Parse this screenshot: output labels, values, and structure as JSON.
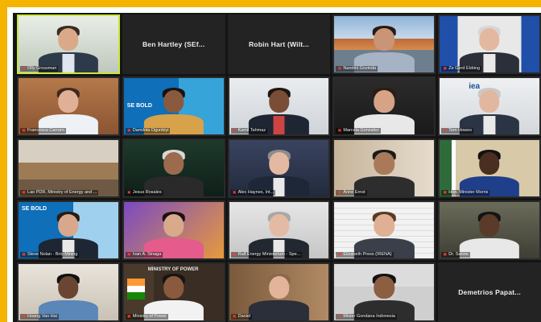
{
  "meeting": {
    "tiles": [
      {
        "name": "Olly Grossman",
        "muted": true
      },
      {
        "center": "Ben Hartley (SEf..."
      },
      {
        "center": "Robin Hart (Wilt..."
      },
      {
        "name": "Nandini Govinda",
        "muted": true
      },
      {
        "name": "Ze Gerd Ebbing",
        "muted": true
      },
      {
        "name": "Francesca Carraro",
        "muted": true
      },
      {
        "name": "Damilola Ogunbiyi",
        "muted": true
      },
      {
        "name": "Kamil Tahmaz",
        "muted": true
      },
      {
        "name": "Marcela Gonzalez",
        "muted": true
      },
      {
        "name": "Tom Howes",
        "muted": true
      },
      {
        "name": "Lao PDR, Ministry of Energy and ...",
        "muted": true
      },
      {
        "name": "Jesus Rosales",
        "muted": true
      },
      {
        "name": "Alec Haynes, Int...",
        "muted": true
      },
      {
        "name": "Anne Ernst",
        "muted": true
      },
      {
        "name": "Hon. Minister Morris",
        "muted": true
      },
      {
        "name": "Steve Nolan - Brio Mining",
        "muted": true
      },
      {
        "name": "Ivan A. Sinaga",
        "muted": true
      },
      {
        "name": "Ralf Energy Ministerium - Spe...",
        "muted": true
      },
      {
        "name": "Elizabeth Press (IRENA)",
        "muted": true
      },
      {
        "name": "Dr. Sanne",
        "muted": true
      },
      {
        "name": "Hoang Van Hai",
        "muted": true
      },
      {
        "name": "Ministry of Power",
        "muted": true
      },
      {
        "name": "Daniel",
        "muted": true
      },
      {
        "name": "Mister Gondana Indonesia",
        "muted": true
      },
      {
        "center": "Demetrios Papat..."
      }
    ],
    "logos": {
      "sebold": "SE BOLD",
      "iea": "iea",
      "ministry_sign": "MINISTRY OF POWER"
    },
    "colors": {
      "accent_frame": "#f5b400",
      "active_speaker": "#c8e83a",
      "muted_mic": "#ff3b30"
    }
  }
}
